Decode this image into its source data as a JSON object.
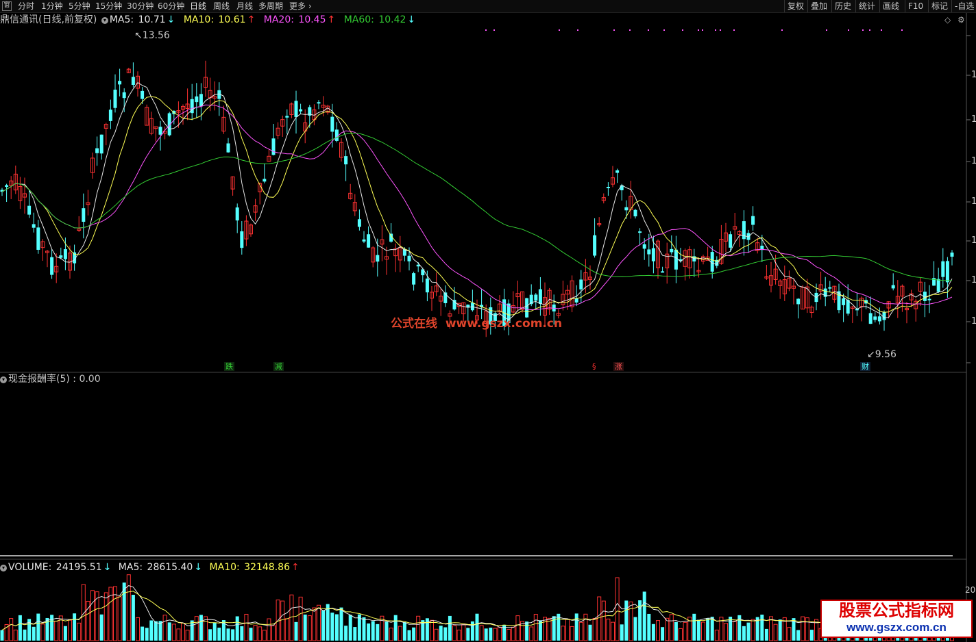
{
  "toolbar": {
    "left_icon": "窗",
    "periods": [
      "分时",
      "1分钟",
      "5分钟",
      "15分钟",
      "30分钟",
      "60分钟",
      "日线",
      "周线",
      "月线",
      "多周期",
      "更多"
    ],
    "selected_period": "日线",
    "right_buttons": [
      "复权",
      "叠加",
      "历史",
      "统计",
      "画线",
      "F10",
      "标记",
      "-自选"
    ]
  },
  "main_panel": {
    "stock_title": "鼎信通讯(日线,前复权)",
    "ma5_label": "MA5:",
    "ma5_value": "10.71",
    "ma5_arrow": "↓",
    "ma10_label": "MA10:",
    "ma10_value": "10.61",
    "ma10_arrow": "↑",
    "ma20_label": "MA20:",
    "ma20_value": "10.45",
    "ma20_arrow": "↑",
    "ma60_label": "MA60:",
    "ma60_value": "10.42",
    "ma60_arrow": "↓",
    "high_label": "13.56",
    "low_label": "9.56",
    "axis_glyph": "1",
    "markers": [
      "跌",
      "减",
      "§",
      "涨",
      "财"
    ]
  },
  "indicator_panel": {
    "title": "现金报酬率(5) : 0.00"
  },
  "volume_panel": {
    "vol_label": "VOLUME:",
    "vol_value": "24195.51",
    "vol_arrow": "↓",
    "ma5_label": "MA5:",
    "ma5_value": "28615.40",
    "ma5_arrow": "↓",
    "ma10_label": "MA10:",
    "ma10_value": "32148.86",
    "ma10_arrow": "↑",
    "axis_partial": "20"
  },
  "watermarks": {
    "center_cn": "公式在线",
    "center_url": "www.gszx.com.cn",
    "logo_cn": "股票公式指标网",
    "logo_url": "www.gszx.com.cn"
  },
  "colors": {
    "up": "#ff3232",
    "down": "#54ffff",
    "ma5": "#e8e8e8",
    "ma10": "#ffff55",
    "ma20": "#ff55ff",
    "ma60": "#33cc33",
    "watermark": "#e0442b"
  }
}
